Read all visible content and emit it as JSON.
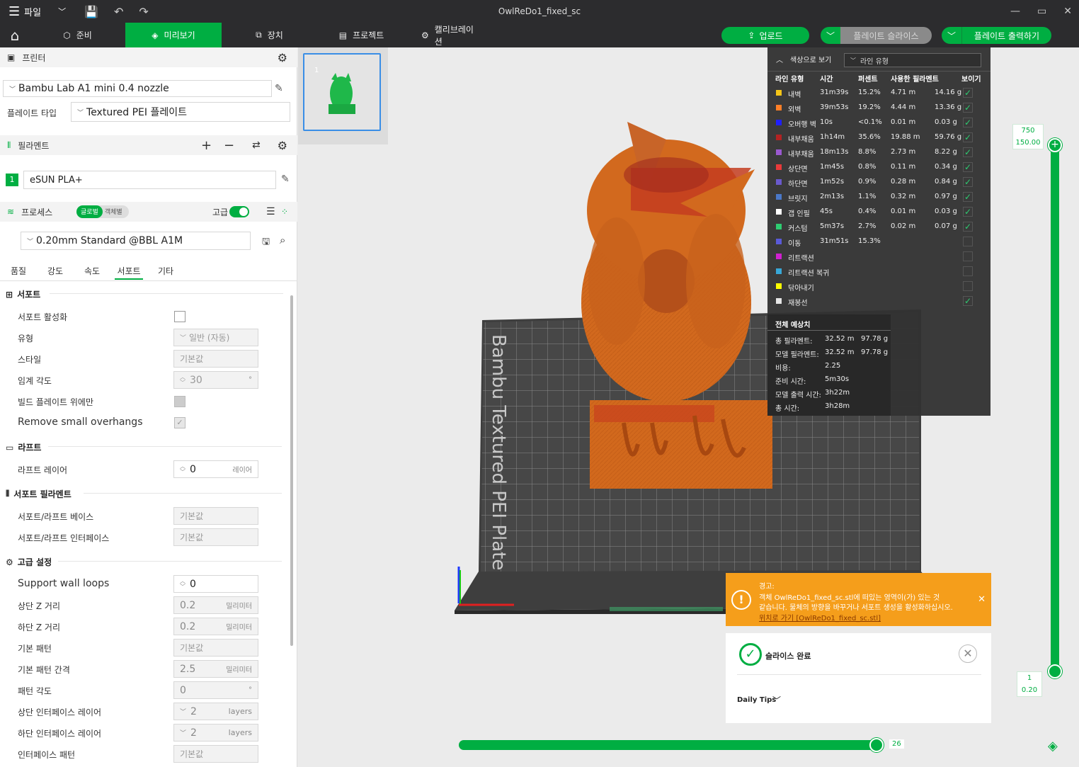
{
  "app": {
    "title": "OwlReDo1_fixed_sc",
    "file_menu": "파일"
  },
  "nav": {
    "tabs": [
      "준비",
      "미리보기",
      "장치",
      "프로젝트",
      "캘리브레이션"
    ],
    "upload": "업로드",
    "slice_plate": "플레이트 슬라이스",
    "print_plate": "플레이트 출력하기"
  },
  "printer": {
    "section": "프린터",
    "name": "Bambu Lab A1 mini 0.4 nozzle",
    "plate_type_label": "플레이트 타입",
    "plate_type": "Textured PEI 플레이트"
  },
  "filament": {
    "section": "필라멘트",
    "slot": "1",
    "name": "eSUN PLA+"
  },
  "process": {
    "section": "프로세스",
    "toggle_global": "글로벌",
    "toggle_object": "객체별",
    "advanced_label": "고급",
    "preset": "0.20mm Standard @BBL A1M",
    "tabs": [
      "품질",
      "강도",
      "속도",
      "서포트",
      "기타"
    ],
    "active_tab": "서포트"
  },
  "support": {
    "group": "서포트",
    "enable_label": "서포트 활성화",
    "type_label": "유형",
    "type_value": "일반 (자동)",
    "style_label": "스타일",
    "style_value": "기본값",
    "threshold_label": "임계 각도",
    "threshold_value": "30",
    "threshold_unit": "°",
    "build_plate_only_label": "빌드 플레이트 위에만",
    "remove_small_label": "Remove small overhangs"
  },
  "raft": {
    "group": "라프트",
    "layers_label": "라프트 레이어",
    "layers_value": "0",
    "layers_unit": "레이어"
  },
  "support_filament": {
    "group": "서포트 필라멘트",
    "base_label": "서포트/라프트 베이스",
    "base_value": "기본값",
    "interface_label": "서포트/라프트 인터페이스",
    "interface_value": "기본값"
  },
  "advanced": {
    "group": "고급 설정",
    "wall_loops_label": "Support wall loops",
    "wall_loops_value": "0",
    "top_z_label": "상단 Z 거리",
    "top_z_value": "0.2",
    "bottom_z_label": "하단 Z 거리",
    "bottom_z_value": "0.2",
    "mm_unit": "밀리미터",
    "base_pattern_label": "기본 패턴",
    "base_pattern_value": "기본값",
    "base_spacing_label": "기본 패턴 간격",
    "base_spacing_value": "2.5",
    "pattern_angle_label": "패턴 각도",
    "pattern_angle_value": "0",
    "pattern_angle_unit": "°",
    "top_iface_label": "상단 인터페이스 레이어",
    "top_iface_value": "2",
    "bottom_iface_label": "하단 인터페이스 레이어",
    "bottom_iface_value": "2",
    "layers_unit": "layers",
    "iface_pattern_label": "인터페이스 패턴",
    "iface_pattern_value": "기본값"
  },
  "plate": {
    "thumb_index": "1",
    "bed_text": "Bambu Textured PEI Plate"
  },
  "legend": {
    "title": "색상으로 보기",
    "mode": "라인 유형",
    "columns": [
      "라인 유형",
      "시간",
      "퍼센트",
      "사용한 필라멘트",
      "보이기"
    ],
    "rows": [
      {
        "name": "내벽",
        "color": "#f5c518",
        "time": "31m39s",
        "pct": "15.2%",
        "len": "4.71 m",
        "wt": "14.16 g",
        "visible": true
      },
      {
        "name": "외벽",
        "color": "#ff7f27",
        "time": "39m53s",
        "pct": "19.2%",
        "len": "4.44 m",
        "wt": "13.36 g",
        "visible": true
      },
      {
        "name": "오버행 벽",
        "color": "#1f1fff",
        "time": "10s",
        "pct": "<0.1%",
        "len": "0.01 m",
        "wt": "0.03 g",
        "visible": true
      },
      {
        "name": "내부채움",
        "color": "#b22222",
        "time": "1h14m",
        "pct": "35.6%",
        "len": "19.88 m",
        "wt": "59.76 g",
        "visible": true
      },
      {
        "name": "내부채움",
        "color": "#9b59d0",
        "time": "18m13s",
        "pct": "8.8%",
        "len": "2.73 m",
        "wt": "8.22 g",
        "visible": true
      },
      {
        "name": "상단면",
        "color": "#e83a3a",
        "time": "1m45s",
        "pct": "0.8%",
        "len": "0.11 m",
        "wt": "0.34 g",
        "visible": true
      },
      {
        "name": "하단면",
        "color": "#6a5acd",
        "time": "1m52s",
        "pct": "0.9%",
        "len": "0.28 m",
        "wt": "0.84 g",
        "visible": true
      },
      {
        "name": "브릿지",
        "color": "#4a78c8",
        "time": "2m13s",
        "pct": "1.1%",
        "len": "0.32 m",
        "wt": "0.97 g",
        "visible": true
      },
      {
        "name": "갭 인필",
        "color": "#ffffff",
        "time": "45s",
        "pct": "0.4%",
        "len": "0.01 m",
        "wt": "0.03 g",
        "visible": true
      },
      {
        "name": "커스텀",
        "color": "#2ecc71",
        "time": "5m37s",
        "pct": "2.7%",
        "len": "0.02 m",
        "wt": "0.07 g",
        "visible": true
      },
      {
        "name": "이동",
        "color": "#5a5ad8",
        "time": "31m51s",
        "pct": "15.3%",
        "len": "",
        "wt": "",
        "visible": false
      },
      {
        "name": "리트랙션",
        "color": "#d020d0",
        "time": "",
        "pct": "",
        "len": "",
        "wt": "",
        "visible": false
      },
      {
        "name": "리트랙션 복귀",
        "color": "#38a8d8",
        "time": "",
        "pct": "",
        "len": "",
        "wt": "",
        "visible": false
      },
      {
        "name": "닦아내기",
        "color": "#ffff00",
        "time": "",
        "pct": "",
        "len": "",
        "wt": "",
        "visible": false
      },
      {
        "name": "재봉선",
        "color": "#e6e6e6",
        "time": "",
        "pct": "",
        "len": "",
        "wt": "",
        "visible": true
      }
    ]
  },
  "estimate": {
    "title": "전체 예상치",
    "rows": [
      {
        "label": "총 필라멘트:",
        "v1": "32.52 m",
        "v2": "97.78 g"
      },
      {
        "label": "모델 필라멘트:",
        "v1": "32.52 m",
        "v2": "97.78 g"
      },
      {
        "label": "비용:",
        "v1": "2.25",
        "v2": ""
      },
      {
        "label": "준비 시간:",
        "v1": "5m30s",
        "v2": ""
      },
      {
        "label": "모델 출력 시간:",
        "v1": "3h22m",
        "v2": ""
      },
      {
        "label": "총 시간:",
        "v1": "3h28m",
        "v2": ""
      }
    ]
  },
  "warning": {
    "title": "경고:",
    "line1": "객체 OwlReDo1_fixed_sc.stl에 떠있는 영역이(가) 있는 것",
    "line2": "같습니다. 물체의 방향을 바꾸거나 서포트 생성을 활성화하십시오.",
    "link": "위치로 가기 [OwlReDo1_fixed_sc.stl]"
  },
  "slice_done": {
    "title": "슬라이스 완료",
    "tips": "Daily Tips"
  },
  "layer_slider": {
    "top_layer": "750",
    "top_height": "150.00",
    "bottom_layer": "1",
    "bottom_height": "0.20",
    "top_fraction": 1.0,
    "bottom_fraction": 0.0
  },
  "move_slider": {
    "value": "26",
    "fraction": 0.99
  },
  "colors": {
    "accent": "#00ae42",
    "warning": "#f59e1b",
    "model": "#d2691e"
  }
}
